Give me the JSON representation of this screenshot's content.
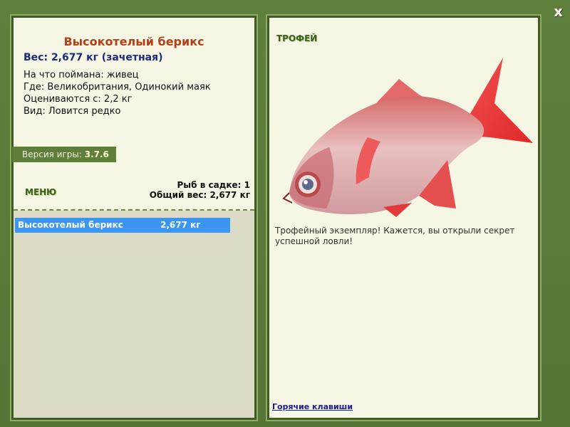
{
  "window": {
    "close_label": "x"
  },
  "fish": {
    "title": "Высокотелый берикс",
    "weight_line": "Вес: 2,677 кг (зачетная)",
    "info": [
      "На что поймана: живец",
      "Где: Великобритания, Одинокий маяк",
      "Оцениваются с: 2,2 кг",
      "Вид: Ловится редко"
    ]
  },
  "version": {
    "label": "Версия игры:",
    "value": "3.7.6"
  },
  "menu": {
    "label": "МЕНЮ"
  },
  "keepnet": {
    "count_line": "Рыб в садке: 1",
    "total_line": "Общий вес: 2,677 кг",
    "rows": [
      {
        "name": "Высокотелый берикс",
        "weight": "2,677 кг"
      }
    ]
  },
  "trophy": {
    "label": "ТРОФЕЙ",
    "text": "Трофейный экземпляр! Кажется, вы открыли секрет успешной ловли!"
  },
  "footer": {
    "hotkeys_link": "Горячие клавиши"
  },
  "colors": {
    "frame": "#5a7a3a",
    "panel_bg": "#f6f6e4",
    "title": "#b3401a",
    "weight": "#1c2a7a",
    "selection": "#3a96f2"
  }
}
